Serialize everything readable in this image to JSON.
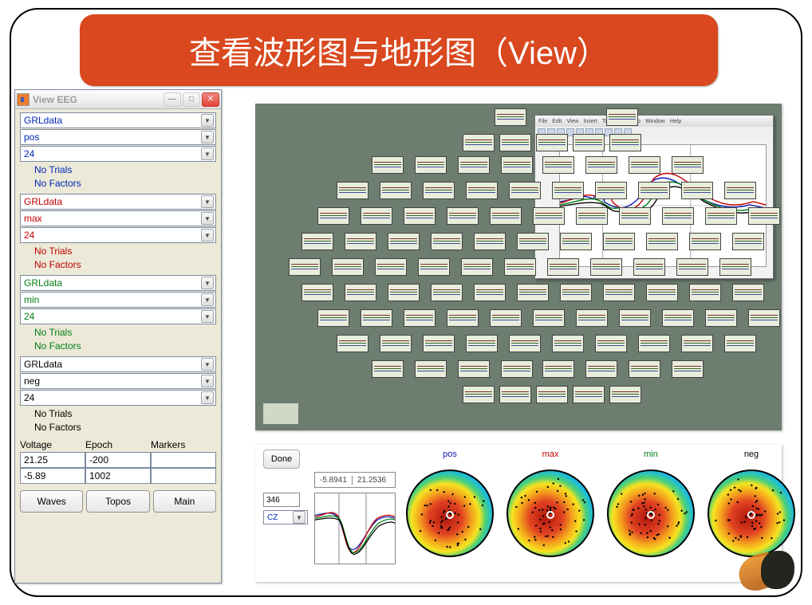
{
  "slide": {
    "title": "查看波形图与地形图（View）"
  },
  "viewer": {
    "window_title": "View EEG",
    "groups": [
      {
        "style": "blue",
        "data": "GRLdata",
        "mode": "pos",
        "ch": "24",
        "t": "No Trials",
        "f": "No Factors"
      },
      {
        "style": "red",
        "data": "GRLdata",
        "mode": "max",
        "ch": "24",
        "t": "No Trials",
        "f": "No Factors"
      },
      {
        "style": "green",
        "data": "GRLdata",
        "mode": "min",
        "ch": "24",
        "t": "No Trials",
        "f": "No Factors"
      },
      {
        "style": "black",
        "data": "GRLdata",
        "mode": "neg",
        "ch": "24",
        "t": "No Trials",
        "f": "No Factors"
      }
    ],
    "table": {
      "headers": [
        "Voltage",
        "Epoch",
        "Markers"
      ],
      "rows": [
        [
          "21.25",
          "-200",
          ""
        ],
        [
          "-5.89",
          "1002",
          ""
        ]
      ]
    },
    "buttons": [
      "Waves",
      "Topos",
      "Main"
    ]
  },
  "detail_menu": [
    "File",
    "Edit",
    "View",
    "Insert",
    "Tools",
    "Desktop",
    "Window",
    "Help"
  ],
  "channels": [
    [
      300,
      6
    ],
    [
      440,
      6
    ],
    [
      260,
      38
    ],
    [
      306,
      38
    ],
    [
      352,
      38
    ],
    [
      398,
      38
    ],
    [
      444,
      38
    ],
    [
      146,
      66
    ],
    [
      200,
      66
    ],
    [
      254,
      66
    ],
    [
      308,
      66
    ],
    [
      360,
      66
    ],
    [
      414,
      66
    ],
    [
      468,
      66
    ],
    [
      522,
      66
    ],
    [
      102,
      98
    ],
    [
      156,
      98
    ],
    [
      210,
      98
    ],
    [
      264,
      98
    ],
    [
      318,
      98
    ],
    [
      372,
      98
    ],
    [
      426,
      98
    ],
    [
      480,
      98
    ],
    [
      534,
      98
    ],
    [
      588,
      98
    ],
    [
      78,
      130
    ],
    [
      132,
      130
    ],
    [
      186,
      130
    ],
    [
      240,
      130
    ],
    [
      294,
      130
    ],
    [
      348,
      130
    ],
    [
      402,
      130
    ],
    [
      456,
      130
    ],
    [
      510,
      130
    ],
    [
      564,
      130
    ],
    [
      618,
      130
    ],
    [
      58,
      162
    ],
    [
      112,
      162
    ],
    [
      166,
      162
    ],
    [
      220,
      162
    ],
    [
      274,
      162
    ],
    [
      328,
      162
    ],
    [
      382,
      162
    ],
    [
      436,
      162
    ],
    [
      490,
      162
    ],
    [
      544,
      162
    ],
    [
      598,
      162
    ],
    [
      42,
      194
    ],
    [
      96,
      194
    ],
    [
      150,
      194
    ],
    [
      204,
      194
    ],
    [
      258,
      194
    ],
    [
      312,
      194
    ],
    [
      366,
      194
    ],
    [
      420,
      194
    ],
    [
      474,
      194
    ],
    [
      528,
      194
    ],
    [
      582,
      194
    ],
    [
      58,
      226
    ],
    [
      112,
      226
    ],
    [
      166,
      226
    ],
    [
      220,
      226
    ],
    [
      274,
      226
    ],
    [
      328,
      226
    ],
    [
      382,
      226
    ],
    [
      436,
      226
    ],
    [
      490,
      226
    ],
    [
      544,
      226
    ],
    [
      598,
      226
    ],
    [
      78,
      258
    ],
    [
      132,
      258
    ],
    [
      186,
      258
    ],
    [
      240,
      258
    ],
    [
      294,
      258
    ],
    [
      348,
      258
    ],
    [
      402,
      258
    ],
    [
      456,
      258
    ],
    [
      510,
      258
    ],
    [
      564,
      258
    ],
    [
      618,
      258
    ],
    [
      102,
      290
    ],
    [
      156,
      290
    ],
    [
      210,
      290
    ],
    [
      264,
      290
    ],
    [
      318,
      290
    ],
    [
      372,
      290
    ],
    [
      426,
      290
    ],
    [
      480,
      290
    ],
    [
      534,
      290
    ],
    [
      588,
      290
    ],
    [
      146,
      322
    ],
    [
      200,
      322
    ],
    [
      254,
      322
    ],
    [
      308,
      322
    ],
    [
      360,
      322
    ],
    [
      414,
      322
    ],
    [
      468,
      322
    ],
    [
      522,
      322
    ],
    [
      260,
      354
    ],
    [
      306,
      354
    ],
    [
      352,
      354
    ],
    [
      398,
      354
    ],
    [
      444,
      354
    ]
  ],
  "topo": {
    "done": "Done",
    "range": [
      "-5.8941",
      "21.2536"
    ],
    "sample": "346",
    "channel": "CZ",
    "maps": [
      {
        "label": "pos",
        "cls": "pos"
      },
      {
        "label": "max",
        "cls": "max"
      },
      {
        "label": "min",
        "cls": "min"
      },
      {
        "label": "neg",
        "cls": "neg"
      }
    ]
  },
  "chart_data": {
    "type": "line",
    "title": "Cz",
    "xlim": [
      -200,
      1000
    ],
    "ylim": [
      -6,
      22
    ],
    "series": [
      {
        "name": "pos",
        "color": "#1118b3"
      },
      {
        "name": "max",
        "color": "#c20000"
      },
      {
        "name": "min",
        "color": "#007f16"
      },
      {
        "name": "neg",
        "color": "#000000"
      }
    ]
  }
}
